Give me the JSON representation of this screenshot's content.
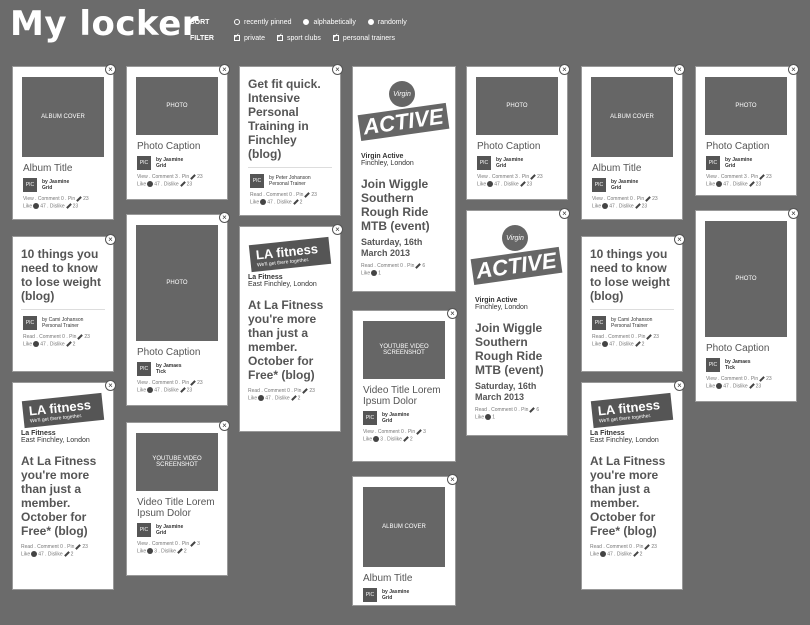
{
  "header": {
    "title": "My locker",
    "sort_label": "SORT",
    "filter_label": "FILTER",
    "sort_options": [
      "recently pinned",
      "alphabetically",
      "randomly"
    ],
    "filter_options": [
      "private",
      "sport clubs",
      "personal trainers"
    ]
  },
  "common": {
    "close": "×",
    "pic": "PIC",
    "photo": "PHOTO",
    "album_cover": "ALBUM COVER",
    "youtube": "YOUTUBE VIDEO SCREENSHOT",
    "by_jasmine": "by Jasmine",
    "grid": "Grid",
    "by_james": "by Jamaes",
    "tick": "Tick",
    "by_peter": "by Peter Johanson",
    "by_cami": "by Cami Johanson",
    "personal_trainer": "Personal Trainer",
    "album_title": "Album Title",
    "photo_caption": "Photo Caption",
    "video_title": "Video Title Lorem Ipsum Dolor",
    "blog1": "Get fit quick. Intensive Personal Training in Finchley (blog)",
    "blog2": "10 things you need to know to lose weight (blog)",
    "event": "Join Wiggle Southern Rough Ride MTB (event)",
    "event_date": "Saturday, 16th March 2013",
    "va_name": "Virgin Active",
    "va_loc": "Finchley, London",
    "va_logo": "ACTIVE",
    "va_top": "Virgin",
    "la_name": "La Fitness",
    "la_loc": "East Finchley, London",
    "la_logo": "LA fitness",
    "la_sub": "We'll get there together.",
    "la_blurb": "At La Fitness you're more than just a member. October for Free* (blog)",
    "stats_view": "View . Comment 0 . Pin",
    "stats_view3": "View . Comment 3 . Pin",
    "stats_read": "Read . Comment 0 . Pin",
    "stats_like": "Like",
    "stats_47": "47",
    "stats_3": "3",
    "stats_dislike": "Dislike",
    "stats_23": "23",
    "stats_2": "2",
    "stats_6": "6",
    "stats_1": "1"
  }
}
